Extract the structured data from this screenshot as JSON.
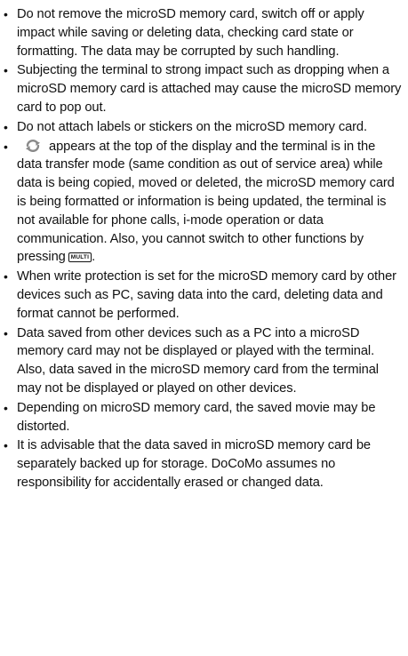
{
  "notes": [
    {
      "text": "Do not remove the microSD memory card, switch off or apply impact while saving or deleting data, checking card state or formatting. The data may be corrupted by such handling."
    },
    {
      "text": "Subjecting the terminal to strong impact such as dropping when a microSD memory card is attached may cause the microSD memory card to pop out."
    },
    {
      "text": "Do not attach labels or stickers on the microSD memory card."
    },
    {
      "icon": "data-transfer-icon",
      "text_before_key": "appears at the top of the display and the terminal is in the data transfer mode (same condition as out of service area) while data is being copied, moved or deleted, the microSD memory card is being formatted or information is being updated, the terminal is not available for phone calls, i-mode operation or data communication. Also, you cannot switch to other functions by pressing",
      "key_label": "MULTI",
      "text_after_key": "."
    },
    {
      "text": "When write protection is set for the microSD memory card by other devices such as PC, saving data into the card, deleting data and format cannot be performed."
    },
    {
      "text": "Data saved from other devices such as a  PC into a microSD memory card may not be displayed or played with the terminal. Also, data saved in the microSD memory card from the terminal may not be displayed or played on other devices."
    },
    {
      "text": "Depending on microSD memory card, the saved movie may be distorted."
    },
    {
      "text": "It is advisable that the data saved in microSD memory card be separately backed up for storage. DoCoMo assumes no responsibility for accidentally erased or changed data."
    }
  ],
  "colors": {
    "text": "#111111",
    "icon_gray": "#8a8a8a",
    "background": "#ffffff"
  }
}
